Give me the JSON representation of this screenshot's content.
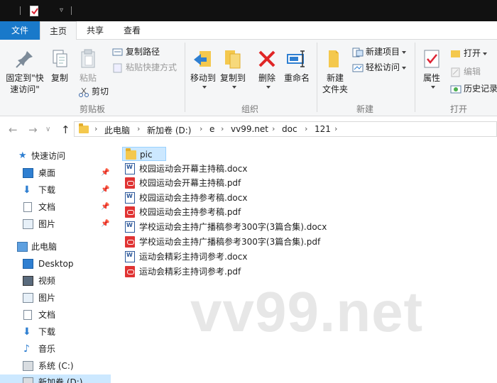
{
  "ribbon_tabs": {
    "file": "文件",
    "home": "主页",
    "share": "共享",
    "view": "查看"
  },
  "clipboard": {
    "pin_quick_access_l1": "固定到\"快",
    "pin_quick_access_l2": "速访问\"",
    "copy": "复制",
    "paste": "粘贴",
    "copy_path": "复制路径",
    "paste_shortcut": "粘贴快捷方式",
    "cut": "剪切",
    "group": "剪贴板"
  },
  "organize": {
    "move_to": "移动到",
    "copy_to": "复制到",
    "delete": "删除",
    "rename": "重命名",
    "group": "组织"
  },
  "new": {
    "new_folder_l1": "新建",
    "new_folder_l2": "文件夹",
    "new_item": "新建项目",
    "easy_access": "轻松访问",
    "group": "新建"
  },
  "open": {
    "properties": "属性",
    "open": "打开",
    "edit": "编辑",
    "history": "历史记录",
    "group": "打开"
  },
  "breadcrumb": [
    "此电脑",
    "新加卷 (D:)",
    "e",
    "vv99.net",
    "doc",
    "121"
  ],
  "nav": {
    "quick_access": "快速访问",
    "desktop_pinned": "桌面",
    "downloads_pinned": "下载",
    "documents_pinned": "文档",
    "pictures_pinned": "图片",
    "this_pc": "此电脑",
    "desktop": "Desktop",
    "videos": "视频",
    "pictures": "图片",
    "documents": "文档",
    "downloads": "下载",
    "music": "音乐",
    "system_c": "系统 (C:)",
    "new_volume_d": "新加卷 (D:)"
  },
  "files": [
    {
      "name": "pic",
      "type": "folder"
    },
    {
      "name": "校园运动会开幕主持稿.docx",
      "type": "docx"
    },
    {
      "name": "校园运动会开幕主持稿.pdf",
      "type": "pdf"
    },
    {
      "name": "校园运动会主持参考稿.docx",
      "type": "docx"
    },
    {
      "name": "校园运动会主持参考稿.pdf",
      "type": "pdf"
    },
    {
      "name": "学校运动会主持广播稿参考300字(3篇合集).docx",
      "type": "docx"
    },
    {
      "name": "学校运动会主持广播稿参考300字(3篇合集).pdf",
      "type": "pdf"
    },
    {
      "name": "运动会精彩主持词参考.docx",
      "type": "docx"
    },
    {
      "name": "运动会精彩主持词参考.pdf",
      "type": "pdf"
    }
  ],
  "watermark": "vv99.net",
  "colors": {
    "accent": "#1979ca",
    "selection": "#cce8ff",
    "folder": "#f4c84d",
    "pdf": "#e03333",
    "word": "#2b579a"
  }
}
